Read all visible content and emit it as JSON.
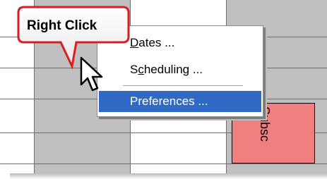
{
  "callout": {
    "label": "Right Click"
  },
  "context_menu": {
    "items": [
      {
        "label_pre": "",
        "accel": "D",
        "label_post": "ates ...",
        "highlighted": false
      },
      {
        "label_pre": "S",
        "accel": "c",
        "label_post": "heduling ...",
        "highlighted": false
      },
      {
        "label_pre": "Preferences ...",
        "accel": "",
        "label_post": "",
        "highlighted": true
      }
    ],
    "highlight_color": "#316ac5"
  },
  "appointment": {
    "label": "Subsc",
    "color": "#f08080"
  },
  "icons": {
    "cursor": "mouse-pointer-icon"
  }
}
